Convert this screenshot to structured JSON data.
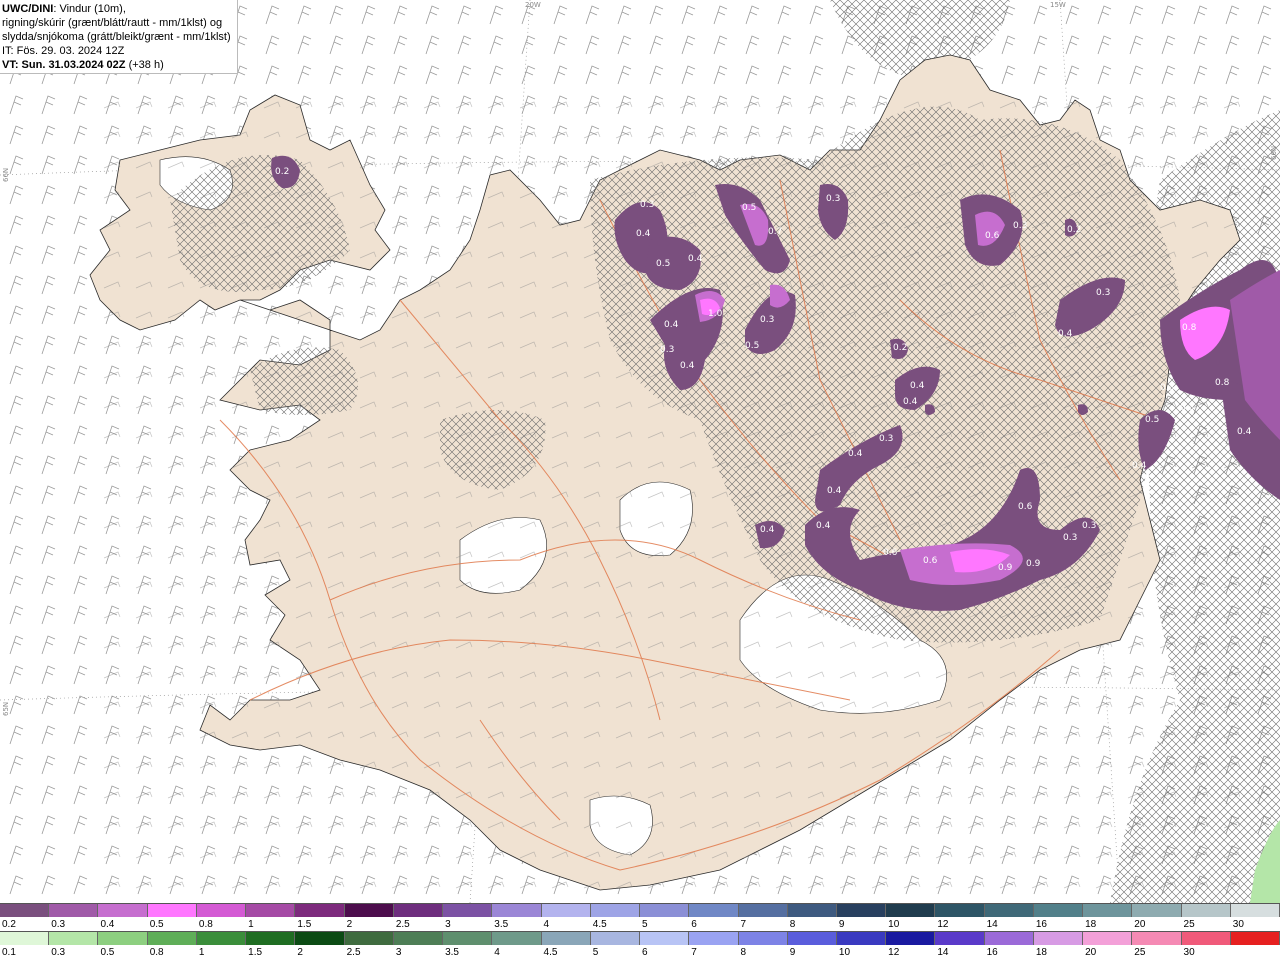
{
  "header": {
    "model": "UWC/DINI",
    "desc1": ": Vindur (10m),",
    "desc2": "rigning/skúrir (grænt/blátt/rautt - mm/1klst) og",
    "desc3": "slydda/snjókoma (grátt/bleikt/grænt - mm/1klst)",
    "it": "IT: Fös. 29. 03. 2024 12Z",
    "vt_bold": "VT: Sun. 31.03.2024 02Z",
    "vt_rest": " (+38 h)"
  },
  "coords": {
    "lon_20w": "20W",
    "lon_15w": "15W",
    "lat_66n_left": "66N",
    "lat_66n_right": "66N",
    "lat_65n": "65N"
  },
  "map_labels": [
    "0.2",
    "0.3",
    "0.4",
    "0.5",
    "0.4",
    "0.5",
    "0.7",
    "0.3",
    "0.6",
    "0.3",
    "0.2",
    "1.0",
    "0.4",
    "0.3",
    "0.4",
    "0.3",
    "0.5",
    "0.2",
    "0.4",
    "0.4",
    "0.4",
    "0.3",
    "0.4",
    "0.4",
    "0.4",
    "0.6",
    "0.3",
    "0.3",
    "0.9",
    "0.9",
    "0.6",
    "0.6",
    "0.8",
    "0.4",
    "0.3",
    "0.5",
    "0.3",
    "0.4",
    "0.8",
    "0.3",
    "0.4"
  ],
  "legend_snow": {
    "labels": [
      "0.2",
      "0.3",
      "0.4",
      "0.5",
      "0.8",
      "1",
      "1.5",
      "2",
      "2.5",
      "3",
      "3.5",
      "4",
      "4.5",
      "5",
      "6",
      "7",
      "8",
      "9",
      "10",
      "12",
      "14",
      "16",
      "18",
      "20",
      "25",
      "30"
    ],
    "colors": [
      "#7a4f7e",
      "#a05aa8",
      "#c66ecf",
      "#ff77ff",
      "#d45ad4",
      "#a54aa5",
      "#7d2a7d",
      "#4d0d4d",
      "#6e2e7e",
      "#7c52a4",
      "#9b86d6",
      "#b3b3ee",
      "#9ea4e6",
      "#8b8fd6",
      "#7088c6",
      "#556fa1",
      "#3e5a80",
      "#28405f",
      "#203c4e",
      "#2e5566",
      "#3f6978",
      "#52808a",
      "#6e959c",
      "#8eabb0",
      "#b6c6c9",
      "#d6dedf"
    ]
  },
  "legend_rain": {
    "labels": [
      "0.1",
      "0.3",
      "0.5",
      "0.8",
      "1",
      "1.5",
      "2",
      "2.5",
      "3",
      "3.5",
      "4",
      "4.5",
      "5",
      "6",
      "7",
      "8",
      "9",
      "10",
      "12",
      "14",
      "16",
      "18",
      "20",
      "25",
      "30"
    ],
    "colors": [
      "#dff7d8",
      "#b4e6a8",
      "#8dcf80",
      "#5fae58",
      "#3b8e3b",
      "#1f6d22",
      "#0c4b14",
      "#3f6b3f",
      "#4e7e56",
      "#5f8f6e",
      "#6f9a8a",
      "#8aa6b8",
      "#a8b6e0",
      "#b8c4f5",
      "#9aa3f2",
      "#7d83e6",
      "#5a5ddc",
      "#3a3ac0",
      "#1a1aa0",
      "#5a3ac9",
      "#9b6ad8",
      "#d79be4",
      "#f3a0d8",
      "#f58ab4",
      "#f05a7a",
      "#e62020"
    ]
  }
}
